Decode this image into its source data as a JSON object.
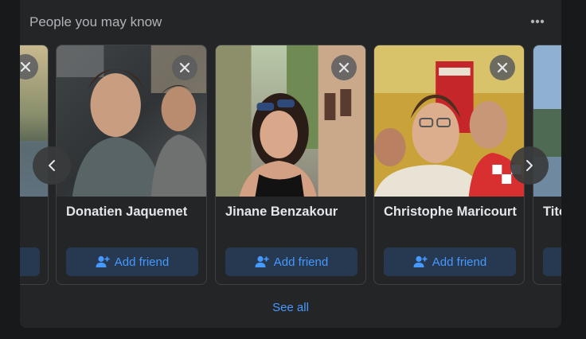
{
  "section": {
    "title": "People you may know",
    "see_all": "See all"
  },
  "cards": [
    {
      "name": "",
      "button": ""
    },
    {
      "name": "Donatien Jaquemet",
      "button": "Add friend"
    },
    {
      "name": "Jinane Benzakour",
      "button": "Add friend"
    },
    {
      "name": "Christophe Maricourt",
      "button": "Add friend"
    },
    {
      "name": "Tito",
      "button": ""
    }
  ],
  "icons": {
    "more": "more-dots-icon",
    "close": "close-icon",
    "prev": "chevron-left-icon",
    "next": "chevron-right-icon",
    "add_friend": "user-plus-icon"
  },
  "colors": {
    "background": "#242526",
    "accent": "#4599ff",
    "button_bg": "#263951",
    "card_border": "#3e4042"
  }
}
